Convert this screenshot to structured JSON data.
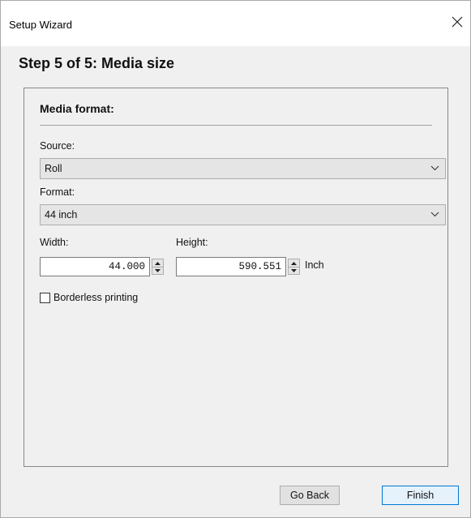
{
  "window": {
    "title": "Setup Wizard",
    "close_icon": "close-icon"
  },
  "step": {
    "title": "Step 5 of 5: Media size"
  },
  "media_format": {
    "group_title": "Media format:",
    "source": {
      "label": "Source:",
      "value": "Roll"
    },
    "format": {
      "label": "Format:",
      "value": "44 inch"
    },
    "width": {
      "label": "Width:",
      "value": "44.000"
    },
    "height": {
      "label": "Height:",
      "value": "590.551"
    },
    "unit": "Inch",
    "borderless": {
      "label": "Borderless printing",
      "checked": false
    }
  },
  "buttons": {
    "back_label": "Go Back",
    "finish_label": "Finish"
  },
  "colors": {
    "accent": "#0078d7",
    "dialog_bg": "#f0f0f0",
    "titlebar_bg": "#ffffff"
  }
}
